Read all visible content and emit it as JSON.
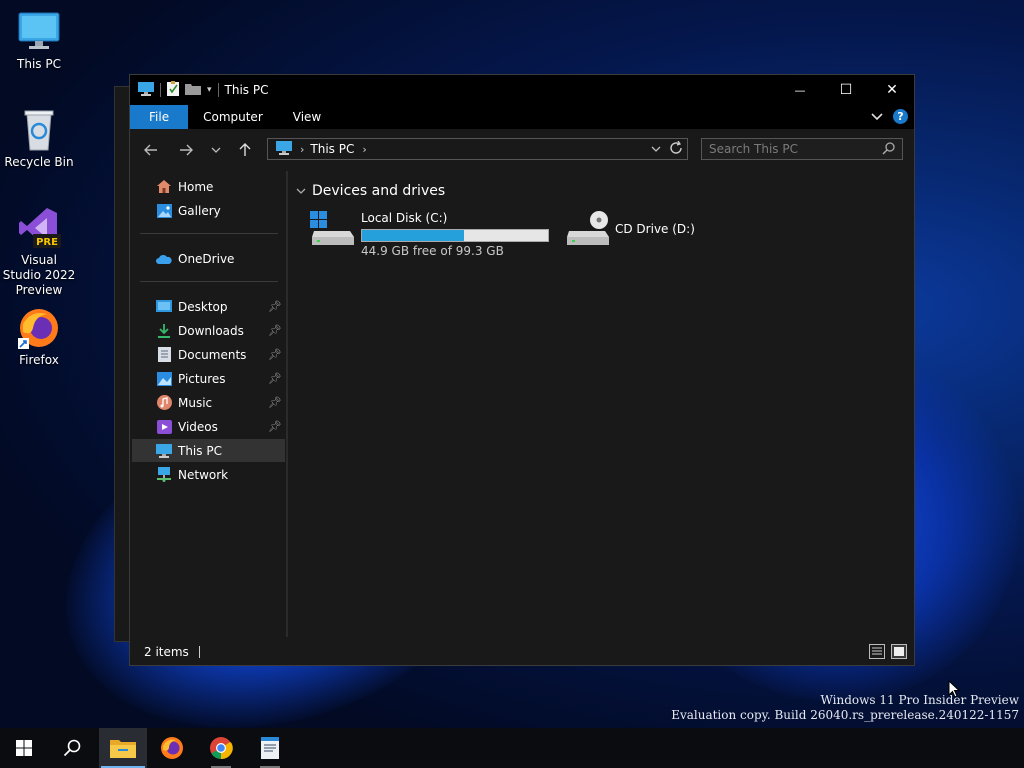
{
  "desktop": {
    "icons": [
      {
        "label": "This PC",
        "icon": "monitor-icon"
      },
      {
        "label": "Recycle Bin",
        "icon": "recycle-bin-icon"
      },
      {
        "label": "Visual Studio 2022 Preview",
        "icon": "visual-studio-icon",
        "badge": "PRE"
      },
      {
        "label": "Firefox",
        "icon": "firefox-icon"
      }
    ],
    "watermark": {
      "line1": "Windows 11 Pro Insider Preview",
      "line2": "Evaluation copy. Build 26040.rs_prerelease.240122-1157"
    }
  },
  "window": {
    "title": "This PC",
    "controls": {
      "minimize": "—",
      "maximize": "☐",
      "close": "✕"
    },
    "ribbon_tabs": [
      "File",
      "Computer",
      "View"
    ],
    "address": {
      "crumb": "This PC"
    },
    "search": {
      "placeholder": "Search This PC"
    },
    "sidebar": {
      "items": [
        {
          "label": "Home",
          "icon": "home-icon"
        },
        {
          "label": "Gallery",
          "icon": "gallery-icon"
        },
        {
          "label": "OneDrive",
          "icon": "onedrive-icon"
        },
        {
          "label": "Desktop",
          "icon": "desktop-folder-icon",
          "pinned": true
        },
        {
          "label": "Downloads",
          "icon": "download-icon",
          "pinned": true
        },
        {
          "label": "Documents",
          "icon": "documents-icon",
          "pinned": true
        },
        {
          "label": "Pictures",
          "icon": "pictures-icon",
          "pinned": true
        },
        {
          "label": "Music",
          "icon": "music-icon",
          "pinned": true
        },
        {
          "label": "Videos",
          "icon": "videos-icon",
          "pinned": true
        },
        {
          "label": "This PC",
          "icon": "this-pc-icon",
          "selected": true
        },
        {
          "label": "Network",
          "icon": "network-icon"
        }
      ]
    },
    "content": {
      "group_header": "Devices and drives",
      "drives": [
        {
          "name": "Local Disk (C:)",
          "free_text": "44.9 GB free of 99.3 GB",
          "used_fraction": 0.548,
          "icon": "windows-drive-icon"
        },
        {
          "name": "CD Drive (D:)",
          "icon": "cd-drive-icon"
        }
      ]
    },
    "status": {
      "item_count": "2 items"
    }
  },
  "taskbar": {
    "buttons": [
      {
        "name": "start-button",
        "icon": "windows-logo-icon"
      },
      {
        "name": "search-button",
        "icon": "search-icon"
      },
      {
        "name": "file-explorer-button",
        "icon": "folder-icon",
        "active": true
      },
      {
        "name": "firefox-button",
        "icon": "firefox-icon"
      },
      {
        "name": "chrome-button",
        "icon": "chrome-icon"
      },
      {
        "name": "app-button",
        "icon": "document-app-icon"
      }
    ]
  },
  "colors": {
    "accent": "#1979ca",
    "progress": "#26a0da",
    "window_bg": "#191919"
  }
}
